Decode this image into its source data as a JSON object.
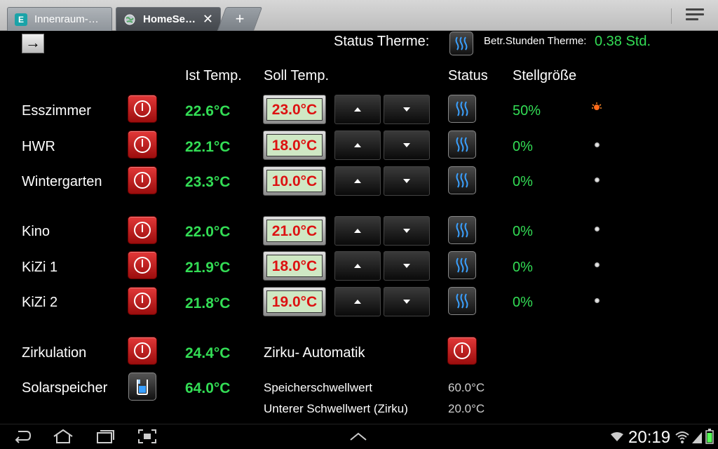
{
  "browser": {
    "tabs": [
      {
        "label": "Innenraum-…",
        "favicon": "E",
        "active": false
      },
      {
        "label": "HomeSe…",
        "favicon": "globe",
        "active": true
      }
    ],
    "new_tab_label": "+"
  },
  "header": {
    "back_label": "→",
    "status_therme_label": "Status Therme:",
    "betr_stunden_label": "Betr.Stunden Therme:",
    "betr_stunden_value": "0.38 Std."
  },
  "columns": {
    "ist": "Ist Temp.",
    "soll": "Soll Temp.",
    "status": "Status",
    "stellgroesse": "Stellgröße"
  },
  "rooms": [
    {
      "name": "Esszimmer",
      "ist": "22.6°C",
      "soll": "23.0°C",
      "stell": "50%",
      "led": "on"
    },
    {
      "name": "HWR",
      "ist": "22.1°C",
      "soll": "18.0°C",
      "stell": "0%",
      "led": "off"
    },
    {
      "name": "Wintergarten",
      "ist": "23.3°C",
      "soll": "10.0°C",
      "stell": "0%",
      "led": "off"
    },
    {
      "name": "Kino",
      "ist": "22.0°C",
      "soll": "21.0°C",
      "stell": "0%",
      "led": "off"
    },
    {
      "name": "KiZi 1",
      "ist": "21.9°C",
      "soll": "18.0°C",
      "stell": "0%",
      "led": "off"
    },
    {
      "name": "KiZi 2",
      "ist": "21.8°C",
      "soll": "19.0°C",
      "stell": "0%",
      "led": "off"
    }
  ],
  "zirkulation": {
    "name": "Zirkulation",
    "temp": "24.4°C",
    "automatik_label": "Zirku- Automatik"
  },
  "solarspeicher": {
    "name": "Solarspeicher",
    "temp": "64.0°C",
    "speicher_label": "Speicherschwellwert",
    "speicher_value": "60.0°C",
    "unterer_label": "Unterer Schwellwert (Zirku)",
    "unterer_value": "20.0°C"
  },
  "system": {
    "clock": "20:19"
  },
  "colors": {
    "green_value": "#33dd55",
    "soll_text": "#dd1111",
    "power_red": "#c41e1e",
    "heat_blue": "#3aa0ff"
  }
}
